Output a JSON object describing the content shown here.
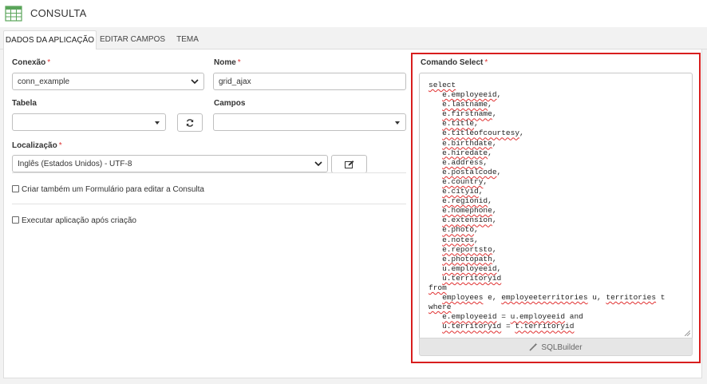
{
  "header": {
    "title": "CONSULTA",
    "icon": "table-grid-icon"
  },
  "tabs": [
    {
      "label": "DADOS DA APLICAÇÃO",
      "active": true
    },
    {
      "label": "EDITAR CAMPOS",
      "active": false
    },
    {
      "label": "TEMA",
      "active": false
    }
  ],
  "form": {
    "required_mark": "*",
    "conexao": {
      "label": "Conexão",
      "value": "conn_example"
    },
    "nome": {
      "label": "Nome",
      "value": "grid_ajax"
    },
    "tabela": {
      "label": "Tabela",
      "value": ""
    },
    "campos": {
      "label": "Campos",
      "value": ""
    },
    "localizacao": {
      "label": "Localização",
      "value": "Inglês (Estados Unidos) - UTF-8"
    },
    "criar_formulario": {
      "label": "Criar também um Formulário para editar a Consulta",
      "checked": false
    },
    "executar_app": {
      "label": "Executar aplicação após criação",
      "checked": false
    }
  },
  "sql": {
    "label": "Comando Select",
    "lines": [
      "select",
      "   e.employeeid,",
      "   e.lastname,",
      "   e.firstname,",
      "   e.title,",
      "   e.titleofcourtesy,",
      "   e.birthdate,",
      "   e.hiredate,",
      "   e.address,",
      "   e.postalcode,",
      "   e.country,",
      "   e.cityid,",
      "   e.regionid,",
      "   e.homephone,",
      "   e.extension,",
      "   e.photo,",
      "   e.notes,",
      "   e.reportsto,",
      "   e.photopath,",
      "   u.employeeid,",
      "   u.territoryid",
      "from",
      "   employees e, employeeterritories u, territories t",
      "where",
      "   e.employeeid = u.employeeid and",
      "   u.territoryid = t.territoryid"
    ],
    "builder_label": "SQLBuilder"
  },
  "colors": {
    "highlight": "#d81e1e",
    "required": "#d33333"
  }
}
